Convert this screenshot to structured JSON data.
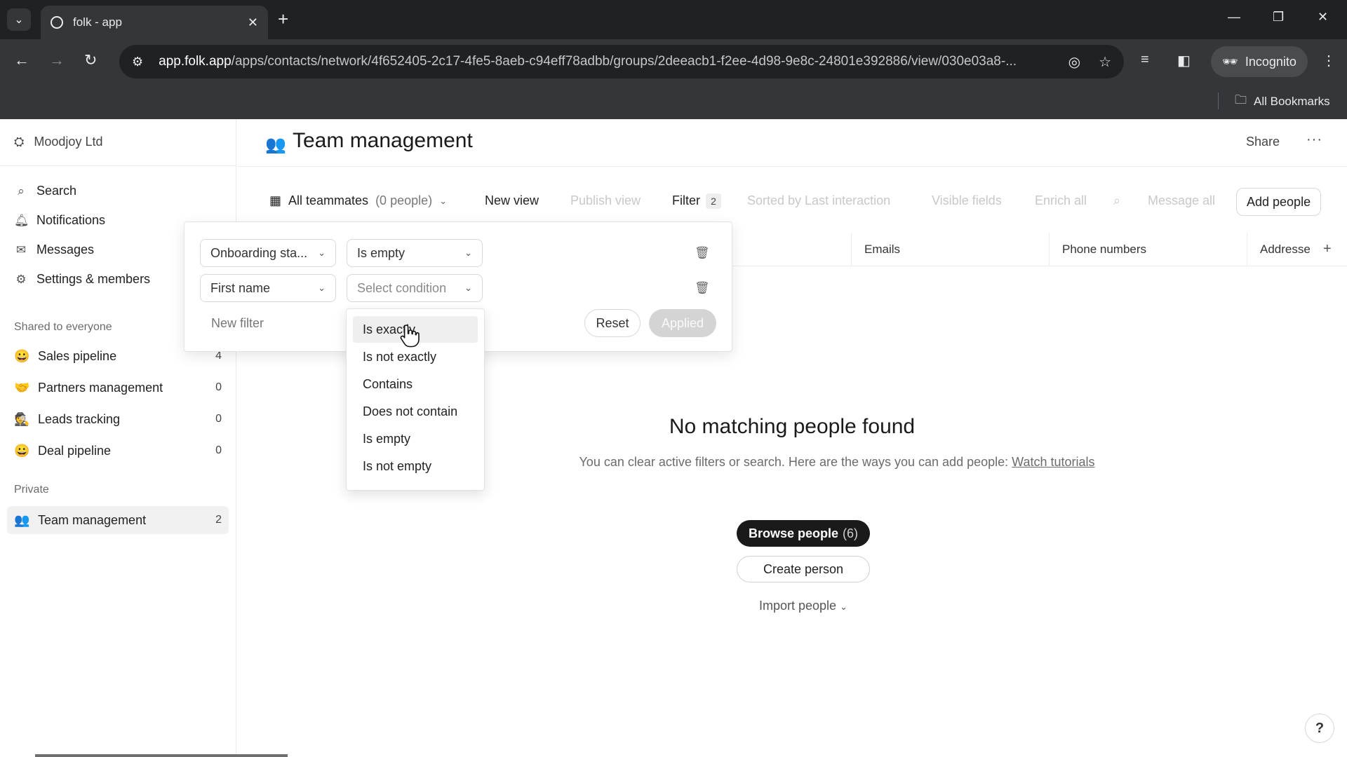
{
  "browser": {
    "tab_title": "folk - app",
    "url_host": "app.folk.app",
    "url_path": "/apps/contacts/network/4f652405-2c17-4fe5-8aeb-c94eff78adbb/groups/2deeacb1-f2ee-4d98-9e8c-24801e392886/view/030e03a8-...",
    "incognito_label": "Incognito",
    "all_bookmarks_label": "All Bookmarks"
  },
  "sidebar": {
    "workspace": "Moodjoy Ltd",
    "nav": [
      {
        "label": "Search",
        "icon": "search-icon"
      },
      {
        "label": "Notifications",
        "icon": "bell-icon"
      },
      {
        "label": "Messages",
        "icon": "mail-icon"
      },
      {
        "label": "Settings & members",
        "icon": "gear-icon"
      }
    ],
    "shared_section": "Shared to everyone",
    "shared_groups": [
      {
        "emoji": "😀",
        "label": "Sales pipeline",
        "count": "4"
      },
      {
        "emoji": "🤝",
        "label": "Partners management",
        "count": "0"
      },
      {
        "emoji": "🕵",
        "label": "Leads tracking",
        "count": "0"
      },
      {
        "emoji": "😀",
        "label": "Deal pipeline",
        "count": "0"
      }
    ],
    "private_section": "Private",
    "private_groups": [
      {
        "emoji": "👥",
        "label": "Team management",
        "count": "2"
      }
    ]
  },
  "header": {
    "title": "Team management",
    "share_label": "Share",
    "more_label": "···"
  },
  "view_bar": {
    "view_name": "All teammates",
    "view_count": "(0 people)",
    "new_view": "New view",
    "publish_view": "Publish view",
    "filter_label": "Filter",
    "filter_count": "2",
    "sorted_label": "Sorted by Last interaction",
    "visible_fields": "Visible fields",
    "enrich_all": "Enrich all",
    "message_all": "Message all",
    "add_people": "Add people"
  },
  "table": {
    "columns": [
      "Emails",
      "Phone numbers",
      "Addresse"
    ]
  },
  "empty_state": {
    "title": "No matching people found",
    "description": "You can clear active filters or search. Here are the ways you can add people:",
    "link": "Watch tutorials",
    "browse_label": "Browse people",
    "browse_count": "(6)",
    "create_label": "Create person",
    "import_label": "Import people"
  },
  "filter_popover": {
    "rows": [
      {
        "field": "Onboarding sta...",
        "condition": "Is empty"
      },
      {
        "field": "First name",
        "condition": "Select condition"
      }
    ],
    "new_filter": "New filter",
    "reset": "Reset",
    "applied": "Applied"
  },
  "condition_menu": {
    "options": [
      "Is exactly",
      "Is not exactly",
      "Contains",
      "Does not contain",
      "Is empty",
      "Is not empty"
    ],
    "hovered": "Is exactly"
  },
  "help_label": "?"
}
